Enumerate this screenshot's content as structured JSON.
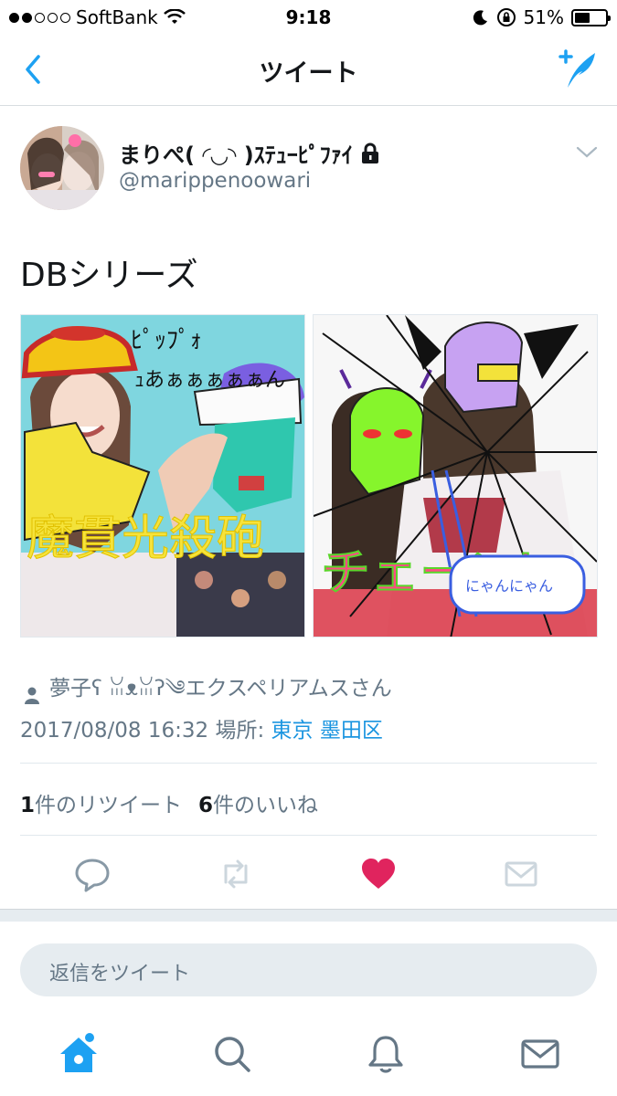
{
  "status_bar": {
    "carrier": "SoftBank",
    "time": "9:18",
    "battery": "51%"
  },
  "nav": {
    "title": "ツイート"
  },
  "tweet": {
    "display_name": "まりぺ( ◜◡◝ )ｽﾃｭｰﾋﾟﾌｧｲ",
    "handle": "@marippenoowari",
    "text": "DBシリーズ",
    "photo_texts": [
      "ﾋﾟｯﾌﾟｫ",
      "ｭあぁぁぁぁぁん",
      "魔貫光殺砲",
      "チェーン!",
      "にゃんにゃん"
    ],
    "tagged_user": "夢子ʕ ꈍᴥꈍʔ༄エクスペリアムスさん",
    "timestamp": "2017/08/08 16:32",
    "location_label": "場所:",
    "location": "東京 墨田区",
    "retweet_count": "1",
    "retweet_label": "件のリツイート",
    "like_count": "6",
    "like_label": "件のいいね"
  },
  "reply": {
    "placeholder": "返信をツイート"
  },
  "colors": {
    "accent": "#1da1f2",
    "like": "#e0245e",
    "muted": "#657786"
  },
  "icons": {
    "back": "chevron-left-icon",
    "compose": "quill-plus-icon",
    "lock": "lock-icon",
    "caret": "chevron-down-icon",
    "reply": "speech-bubble-icon",
    "retweet": "retweet-icon",
    "like": "heart-icon",
    "dm": "envelope-icon",
    "tabs": [
      "home-icon",
      "search-icon",
      "bell-icon",
      "envelope-icon"
    ]
  }
}
